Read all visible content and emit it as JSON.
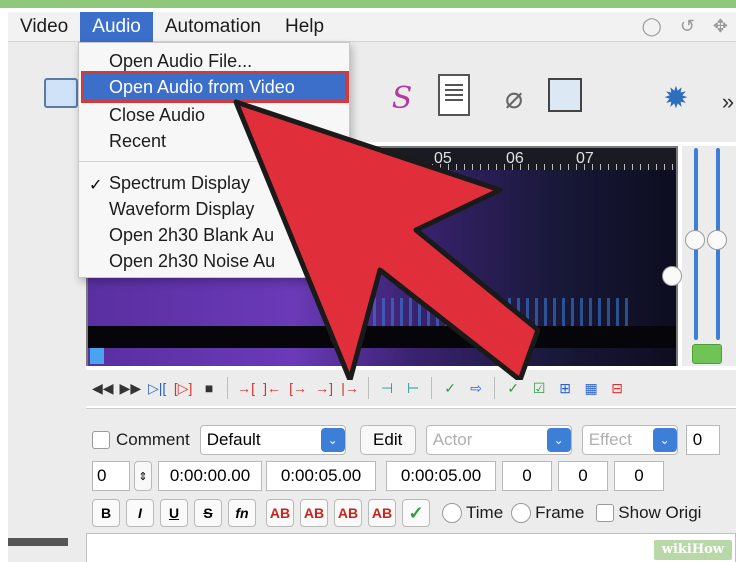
{
  "menubar": {
    "items": [
      "Video",
      "Audio",
      "Automation",
      "Help"
    ],
    "active": "Audio"
  },
  "audio_menu": {
    "items": [
      {
        "label": "Open Audio File...",
        "highlighted": false,
        "checked": false
      },
      {
        "label": "Open Audio from Video",
        "highlighted": true,
        "checked": false
      },
      {
        "label": "Close Audio",
        "highlighted": false,
        "checked": false
      },
      {
        "label": "Recent",
        "highlighted": false,
        "checked": false
      },
      {
        "label": "Spectrum Display",
        "highlighted": false,
        "checked": true
      },
      {
        "label": "Waveform Display",
        "highlighted": false,
        "checked": false
      },
      {
        "label": "Open 2h30 Blank Au",
        "highlighted": false,
        "checked": false
      },
      {
        "label": "Open 2h30 Noise Au",
        "highlighted": false,
        "checked": false
      }
    ],
    "check_mark": "✓"
  },
  "toolbar": {
    "icons": [
      "film-icon",
      "style-s-icon",
      "document-icon",
      "paperclip-icon",
      "copy-text-icon",
      "automation-star-icon"
    ],
    "overflow": "»"
  },
  "spectrum": {
    "ruler_labels": [
      "05",
      "06",
      "07"
    ]
  },
  "transport": {
    "buttons": [
      "◀◀",
      "▶▶",
      "▷|[",
      "[▷]",
      "■",
      "→[",
      "]←",
      "[→",
      "→]",
      "|→",
      "⊣",
      "⊢",
      "✓",
      "⇨",
      "✓",
      "☑",
      "⊞",
      "▦",
      "⊟"
    ]
  },
  "edit": {
    "comment_label": "Comment",
    "style_value": "Default",
    "edit_button": "Edit",
    "actor_placeholder": "Actor",
    "effect_placeholder": "Effect",
    "layer_value": "0",
    "start_layer": "0",
    "start_time": "0:00:00.00",
    "end_time": "0:00:05.00",
    "duration": "0:00:05.00",
    "margin_l": "0",
    "margin_r": "0",
    "margin_v": "0",
    "format_buttons": [
      "B",
      "I",
      "U",
      "S",
      "fn",
      "AB",
      "AB",
      "AB",
      "AB"
    ],
    "commit": "✓",
    "time_label": "Time",
    "frame_label": "Frame",
    "show_original_label": "Show Origi"
  },
  "colors": {
    "accent_blue": "#3b6fc9",
    "highlight_border": "#d23a3e",
    "arrow_red": "#e02f3a"
  },
  "watermark": "wikiHow"
}
